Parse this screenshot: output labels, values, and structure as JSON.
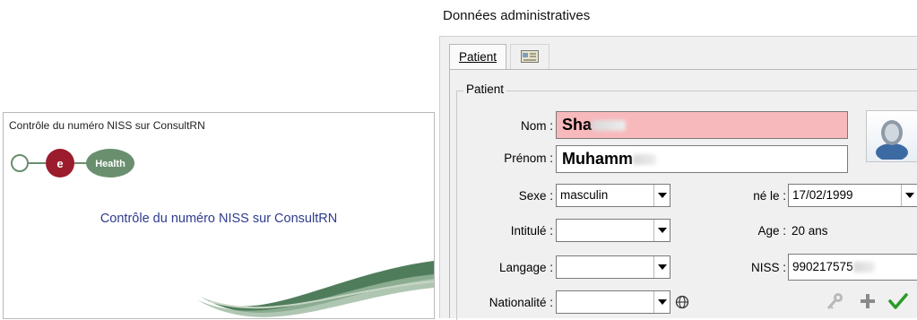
{
  "left": {
    "window_title": "Contrôle du numéro NISS sur ConsultRN",
    "heading": "Contrôle du numéro NISS sur ConsultRN",
    "logo": {
      "letter": "e",
      "word": "Health"
    },
    "colors": {
      "logo_red": "#9b1c2c",
      "logo_green": "#6a8f6f",
      "heading": "#2f3b8f"
    }
  },
  "right": {
    "section_title": "Données administratives",
    "tabs": [
      {
        "label": "Patient"
      },
      {
        "icon": "id-card-icon"
      }
    ],
    "group_label": "Patient",
    "fields": {
      "nom": {
        "label": "Nom :",
        "value": "Sha"
      },
      "prenom": {
        "label": "Prénom :",
        "value": "Muhamm"
      },
      "sexe": {
        "label": "Sexe :",
        "value": "masculin"
      },
      "intitule": {
        "label": "Intitulé :",
        "value": ""
      },
      "langage": {
        "label": "Langage :",
        "value": ""
      },
      "nationalite": {
        "label": "Nationalité :",
        "value": ""
      },
      "ne_le": {
        "label": "né le :",
        "value": "17/02/1999"
      },
      "age": {
        "label": "Age :",
        "value": "20 ans"
      },
      "niss": {
        "label": "NISS :",
        "value": "990217575"
      }
    },
    "icons": [
      "globe-icon",
      "key-icon",
      "plus-icon",
      "check-icon",
      "person-photo-icon"
    ],
    "colors": {
      "required_field": "#f8b9bc",
      "check": "#2a9a2a",
      "plus": "#8a8a8a"
    }
  }
}
